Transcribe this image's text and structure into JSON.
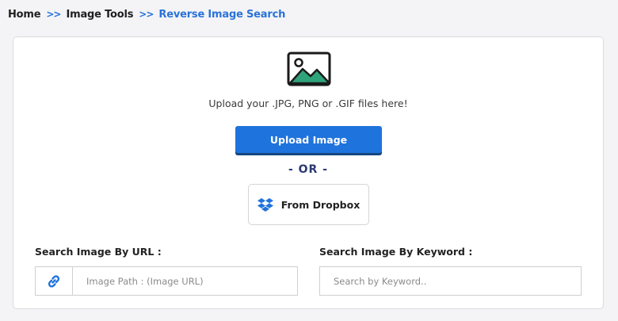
{
  "breadcrumb": {
    "home": "Home",
    "tools": "Image Tools",
    "current": "Reverse Image Search",
    "separator": ">>"
  },
  "upload": {
    "icon": "image-icon",
    "prompt": "Upload your .JPG, PNG or .GIF files here!",
    "button_label": "Upload Image"
  },
  "divider": "- OR -",
  "dropbox": {
    "icon": "dropbox-icon",
    "label": "From Dropbox"
  },
  "url_search": {
    "label": "Search Image By URL :",
    "icon": "link-icon",
    "placeholder": "Image Path : (Image URL)"
  },
  "keyword_search": {
    "label": "Search Image By Keyword :",
    "placeholder": "Search by Keyword.."
  },
  "colors": {
    "accent": "#1f73dc",
    "breadcrumb_active": "#2a73d9",
    "or_text": "#2b3a73",
    "image_icon_green": "#2fa37a"
  }
}
